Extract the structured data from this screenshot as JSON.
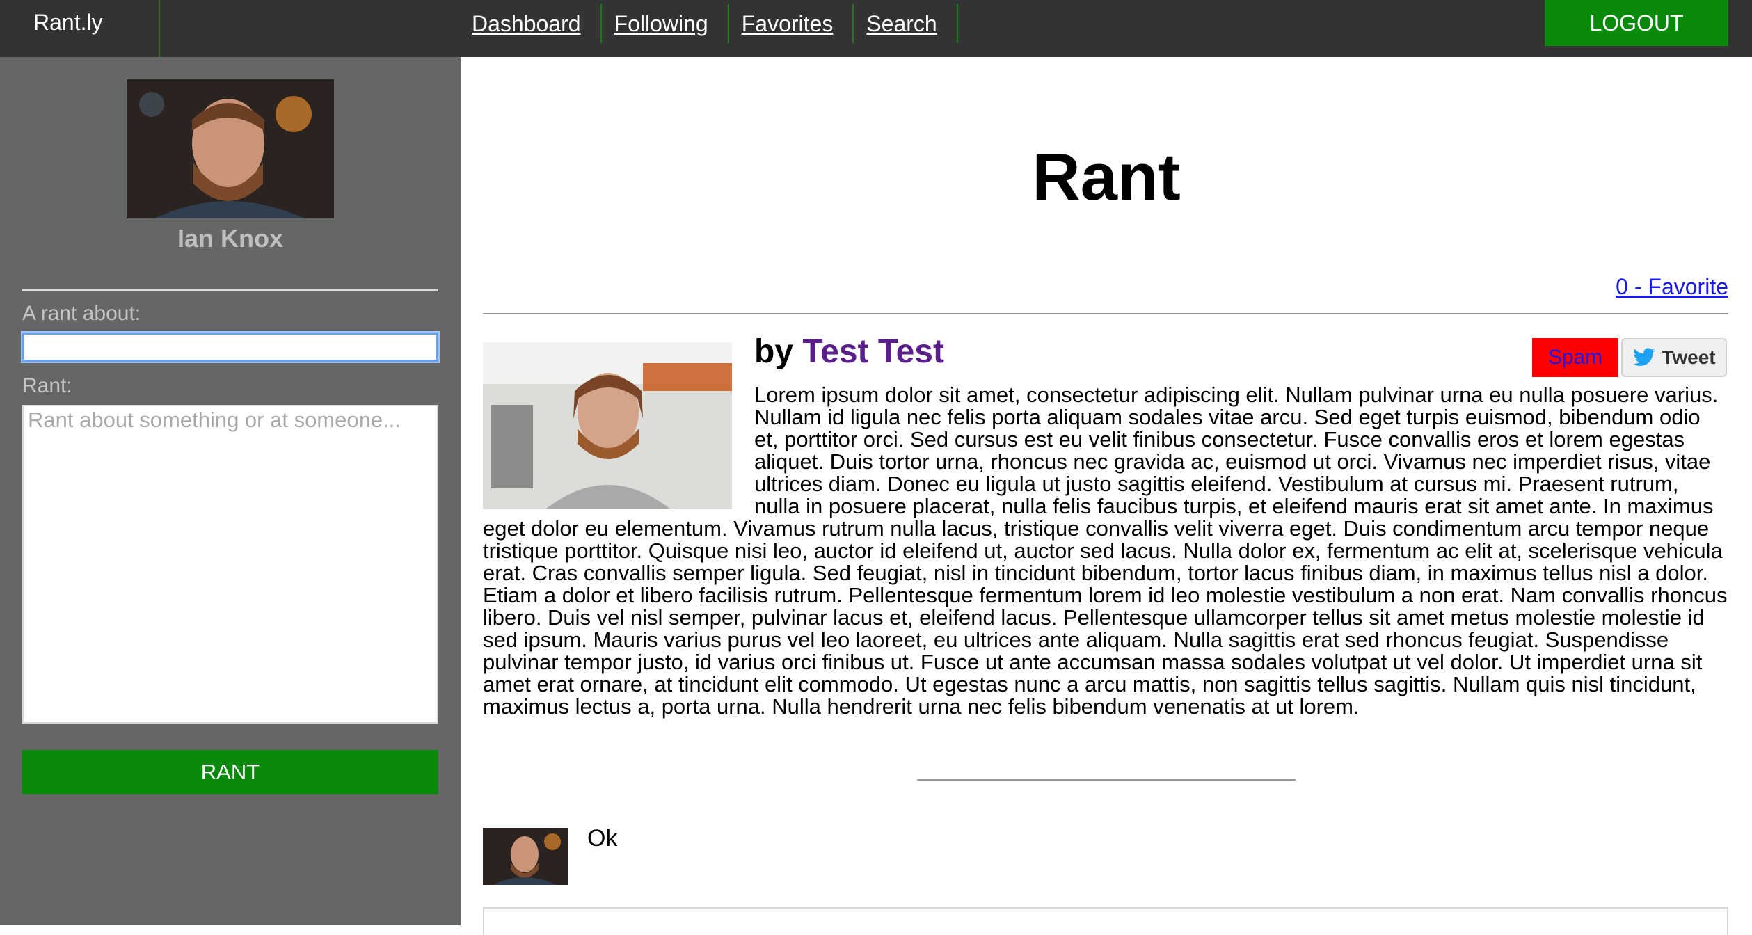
{
  "app": {
    "title": "Rant.ly"
  },
  "nav": {
    "items": [
      {
        "label": "Dashboard"
      },
      {
        "label": "Following"
      },
      {
        "label": "Favorites"
      },
      {
        "label": "Search"
      }
    ],
    "logout_label": "LOGOUT"
  },
  "sidebar": {
    "user_name": "Ian Knox",
    "about_label": "A rant about:",
    "about_value": "",
    "rant_label": "Rant:",
    "rant_placeholder": "Rant about something or at someone...",
    "submit_label": "RANT"
  },
  "main": {
    "title": "Rant",
    "favorite_link": "0 - Favorite",
    "post": {
      "by_prefix": "by",
      "author": "Test Test",
      "spam_label": "Spam",
      "tweet_label": "Tweet",
      "body": "Lorem ipsum dolor sit amet, consectetur adipiscing elit. Nullam pulvinar urna eu nulla posuere varius. Nullam id ligula nec felis porta aliquam sodales vitae arcu. Sed eget turpis euismod, bibendum odio et, porttitor orci. Sed cursus est eu velit finibus consectetur. Fusce convallis eros et lorem egestas aliquet. Duis tortor urna, rhoncus nec gravida ac, euismod ut orci. Vivamus nec imperdiet risus, vitae ultrices diam. Donec eu ligula ut justo sagittis eleifend. Vestibulum at cursus mi. Praesent rutrum, nulla in posuere placerat, nulla felis faucibus turpis, et eleifend mauris erat sit amet ante. In maximus eget dolor eu elementum. Vivamus rutrum nulla lacus, tristique convallis velit viverra eget. Duis condimentum arcu tempor neque tristique porttitor. Quisque nisi leo, auctor id eleifend ut, auctor sed lacus. Nulla dolor ex, fermentum ac elit at, scelerisque vehicula erat. Cras convallis semper ligula. Sed feugiat, nisl in tincidunt bibendum, tortor lacus finibus diam, in maximus tellus nisl a dolor. Etiam a dolor et libero facilisis rutrum. Pellentesque fermentum lorem id leo molestie vestibulum a non erat. Nam convallis rhoncus libero. Duis vel nisl semper, pulvinar lacus et, eleifend lacus. Pellentesque ullamcorper tellus sit amet metus molestie molestie id sed ipsum. Mauris varius purus vel leo laoreet, eu ultrices ante aliquam. Nulla sagittis erat sed rhoncus feugiat. Suspendisse pulvinar tempor justo, id varius orci finibus ut. Fusce ut ante accumsan massa sodales volutpat ut vel dolor. Ut imperdiet urna sit amet erat ornare, at tincidunt elit commodo. Ut egestas nunc a arcu mattis, non sagittis tellus sagittis. Nullam quis nisl tincidunt, maximus lectus a, porta urna. Nulla hendrerit urna nec felis bibendum venenatis at ut lorem."
    },
    "comments": [
      {
        "text": "Ok"
      }
    ]
  },
  "colors": {
    "topbar": "#333333",
    "sidebar": "#666666",
    "accent_green": "#0a8a0a",
    "spam_red": "#ff0000",
    "link_blue": "#1a1aee",
    "author_purple": "#5a1f8a"
  },
  "icons": {
    "tweet": "twitter-bird-icon"
  }
}
